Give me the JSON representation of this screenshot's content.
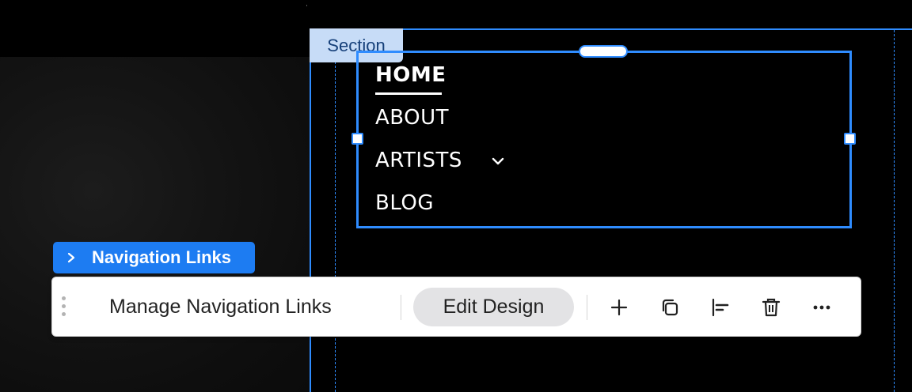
{
  "canvas": {
    "section_tag": "Section",
    "component_tag": "Navigation Links"
  },
  "nav_menu": {
    "items": [
      {
        "label": "HOME",
        "active": true
      },
      {
        "label": "ABOUT"
      },
      {
        "label": "ARTISTS",
        "has_dropdown": true
      },
      {
        "label": "BLOG"
      }
    ]
  },
  "toolbar": {
    "manage_label": "Manage Navigation Links",
    "edit_design_label": "Edit Design",
    "icons": [
      "drag-handle-icon",
      "add-icon",
      "duplicate-icon",
      "align-icon",
      "delete-icon",
      "more-icon"
    ]
  },
  "colors": {
    "selection_blue": "#2f8cff",
    "tag_blue": "#1d7cf2",
    "section_tag_bg": "#c7dcf7",
    "section_tag_text": "#16407a"
  }
}
